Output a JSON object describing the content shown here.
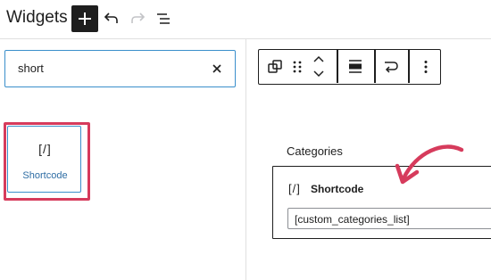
{
  "header": {
    "title": "Widgets"
  },
  "search": {
    "value": "short",
    "clear_glyph": "×"
  },
  "inserter": {
    "result_icon_text": "[/]",
    "result_label": "Shortcode"
  },
  "canvas": {
    "categories_label": "Categories",
    "shortcode_block": {
      "icon_text": "[/]",
      "title": "Shortcode",
      "input_value": "[custom_categories_list]"
    }
  },
  "colors": {
    "accent": "#3a8fcb",
    "highlight": "#d63b5c",
    "dark": "#1e1e1e"
  },
  "icons": [
    "plus-icon",
    "undo-icon",
    "redo-icon",
    "list-view-icon",
    "close-icon",
    "transform-icon",
    "drag-handle-icon",
    "move-up-icon",
    "move-down-icon",
    "align-icon",
    "loop-icon",
    "more-options-icon",
    "annotation-arrow-icon"
  ]
}
